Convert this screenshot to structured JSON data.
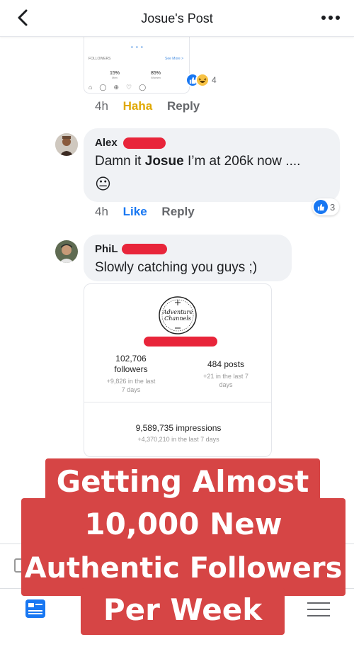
{
  "header": {
    "title": "Josue's Post"
  },
  "top_image": {
    "followers_label": "FOLLOWERS",
    "see_more": "See More  >",
    "pct_men": "15%",
    "men_label": "Men",
    "pct_women": "85%",
    "women_label": "Women"
  },
  "comment1_meta": {
    "time": "4h",
    "reaction_label": "Haha",
    "reply_label": "Reply",
    "reaction_count": "4",
    "reaction_color": "#e0a800"
  },
  "comment2": {
    "author": "Alex",
    "text_prefix": "Damn it ",
    "text_bold": "Josue",
    "text_suffix": " I’m at 206k now ....",
    "emoji": "😐",
    "time": "4h",
    "like_label": "Like",
    "reply_label": "Reply",
    "reaction_count": "3"
  },
  "comment3": {
    "author": "PhiL",
    "text": "Slowly catching you guys ;)"
  },
  "stats_card": {
    "logo_text_line1": "Adventure",
    "logo_text_line2": "Channels",
    "followers_value": "102,706",
    "followers_label": "followers",
    "followers_delta_1": "+9,826 in the last",
    "followers_delta_2": "7 days",
    "posts_value": "484 posts",
    "posts_delta_1": "+21 in the last 7",
    "posts_delta_2": "days",
    "impressions_value": "9,589,735 impressions",
    "impressions_delta": "+4,370,210 in the last 7 days"
  },
  "overlay": {
    "line1": "Getting Almost",
    "line2": "10,000 New",
    "line3": "Authentic Followers",
    "line4": "Per Week",
    "color": "#d64545"
  },
  "icons": {
    "back": "chevron-left-icon",
    "more": "more-dots-icon",
    "news_feed": "news-feed-icon",
    "menu": "hamburger-menu-icon"
  }
}
